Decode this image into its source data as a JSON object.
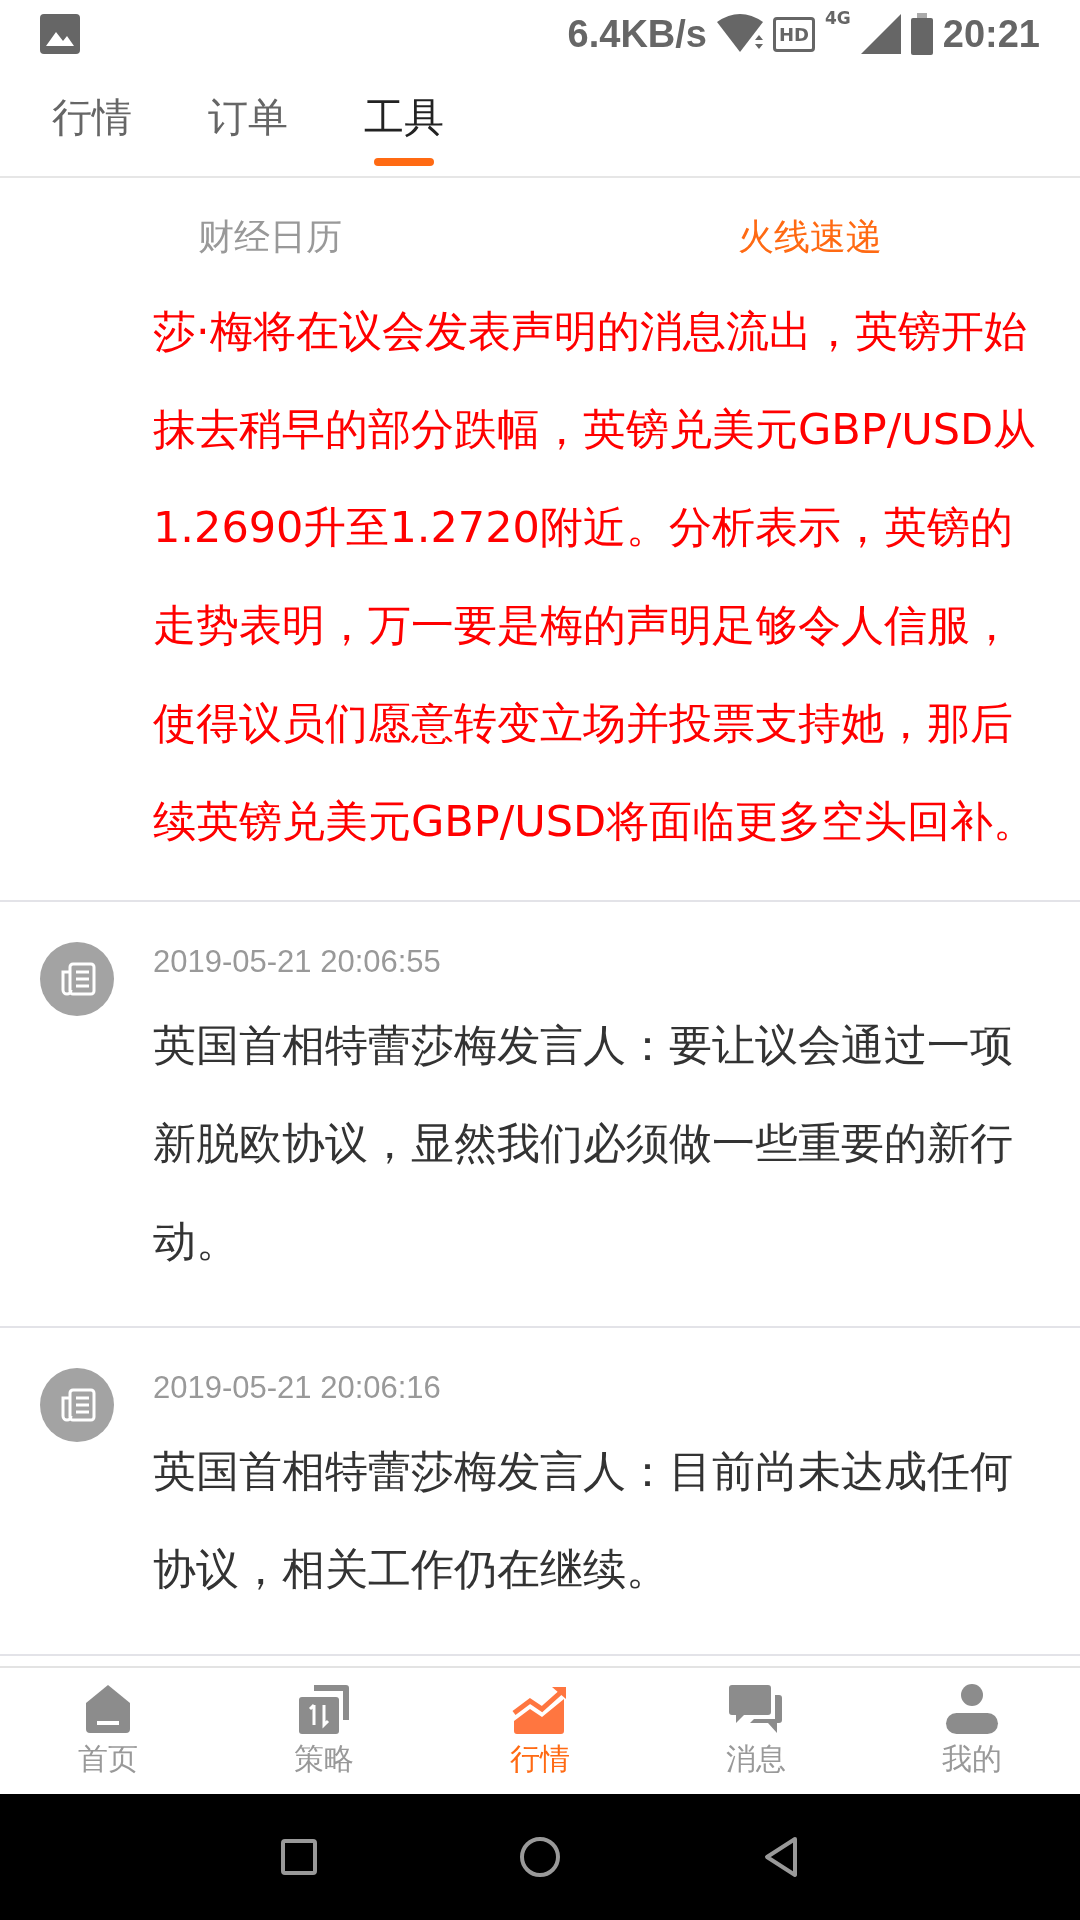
{
  "status_bar": {
    "speed": "6.4KB/s",
    "hd": "HD",
    "network": "4G",
    "time": "20:21"
  },
  "tabs": [
    {
      "label": "行情",
      "selected": false
    },
    {
      "label": "订单",
      "selected": false
    },
    {
      "label": "工具",
      "selected": true
    }
  ],
  "sub_tabs": [
    {
      "label": "财经日历",
      "selected": false
    },
    {
      "label": "火线速递",
      "selected": true
    }
  ],
  "news": [
    {
      "kind": "highlight",
      "text": "莎·梅将在议会发表声明的消息流出，英镑开始抹去稍早的部分跌幅，英镑兑美元GBP/USD从1.2690升至1.2720附近。分析表示，英镑的走势表明，万一要是梅的声明足够令人信服，使得议员们愿意转变立场并投票支持她，那后续英镑兑美元GBP/USD将面临更多空头回补。"
    },
    {
      "kind": "normal",
      "time": "2019-05-21 20:06:55",
      "text": "英国首相特蕾莎梅发言人：要让议会通过一项新脱欧协议，显然我们必须做一些重要的新行动。"
    },
    {
      "kind": "normal",
      "time": "2019-05-21 20:06:16",
      "text": "英国首相特蕾莎梅发言人：目前尚未达成任何协议，相关工作仍在继续。"
    }
  ],
  "bottom_nav": [
    {
      "label": "首页",
      "selected": false
    },
    {
      "label": "策略",
      "selected": false
    },
    {
      "label": "行情",
      "selected": true
    },
    {
      "label": "消息",
      "selected": false
    },
    {
      "label": "我的",
      "selected": false
    }
  ]
}
